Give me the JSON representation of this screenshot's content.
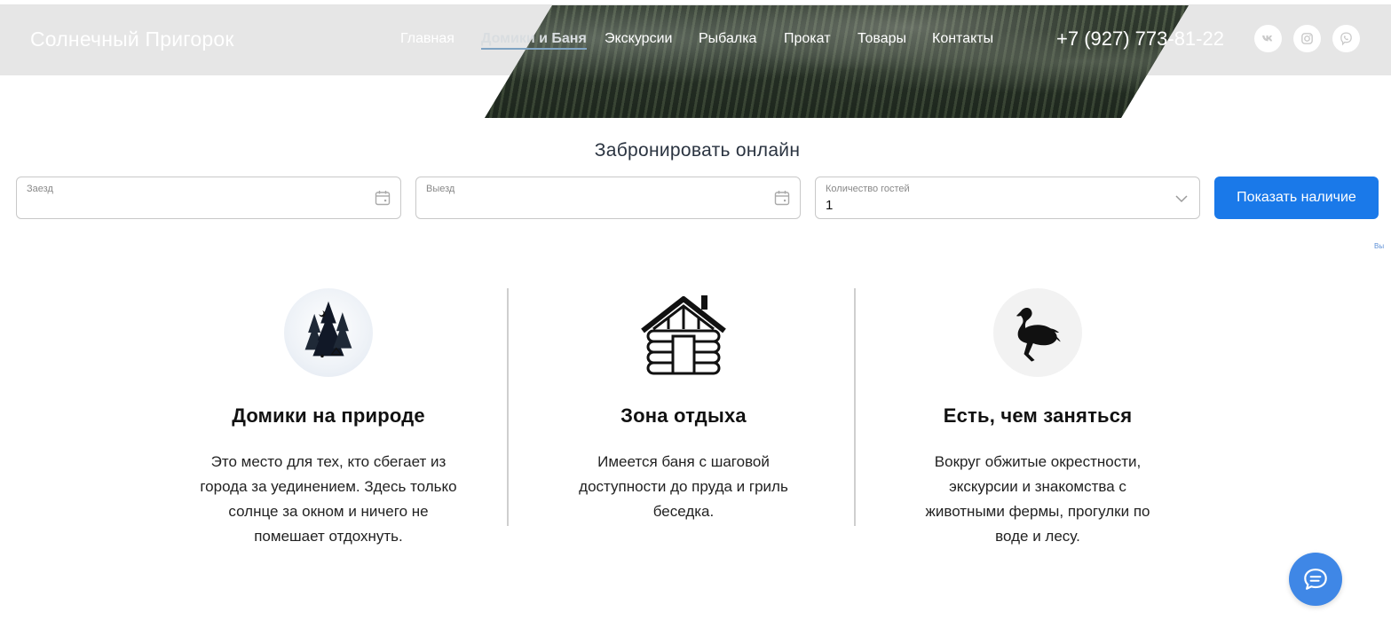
{
  "header": {
    "brand": "Солнечный Пригорок",
    "nav": [
      "Главная",
      "Домики и Баня",
      "Экскурсии",
      "Рыбалка",
      "Прокат",
      "Товары",
      "Контакты"
    ],
    "phone": "+7 (927) 773-81-22",
    "social_icons": [
      "vk-icon",
      "instagram-icon",
      "viber-icon"
    ]
  },
  "booking": {
    "title": "Забронировать онлайн",
    "checkin_label": "Заезд",
    "checkout_label": "Выезд",
    "guests_label": "Количество гостей",
    "guests_value": "1",
    "submit": "Показать наличие",
    "tiny_link": "Вы"
  },
  "features": [
    {
      "icon": "forest-camp-icon",
      "title": "Домики на природе",
      "lines": [
        "Это место для тех, кто сбегает из",
        "города за уединением. Здесь только",
        "солнце за окном и ничего не",
        "помешает отдохнуть."
      ]
    },
    {
      "icon": "log-cabin-icon",
      "title": "Зона отдыха",
      "lines": [
        "Имеется баня с шаговой",
        "доступности до пруда и гриль",
        "беседка."
      ]
    },
    {
      "icon": "ostrich-icon",
      "title": "Есть, чем заняться",
      "lines": [
        "Вокруг обжитые окрестности,",
        "экскурсии и знакомства с",
        "животными фермы, прогулки по",
        "воде и лесу."
      ]
    }
  ],
  "colors": {
    "primary": "#1a79e9",
    "header_bg": "#e6e6e6",
    "chat": "#3f87e6"
  }
}
